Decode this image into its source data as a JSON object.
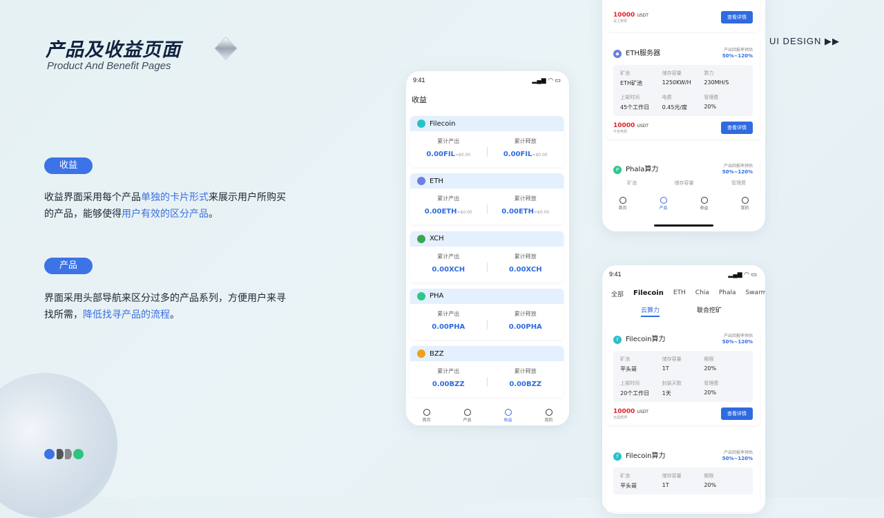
{
  "header": {
    "title": "产品及收益页面",
    "subtitle": "Product And Benefit Pages",
    "tag": "UI DESIGN ▶▶"
  },
  "section1": {
    "pill": "收益",
    "p1a": "收益界面采用每个产品",
    "p1b": "单独的卡片形式",
    "p1c": "来展示用户所购买的产品，能够使得",
    "p1d": "用户有效的区分产品",
    "p1e": "。"
  },
  "section2": {
    "pill": "产品",
    "p2a": "界面采用头部导航来区分过多的产品系列，方便用户来寻找所需，",
    "p2b": "降低找寻产品的流程",
    "p2c": "。"
  },
  "colors": {
    "accent": "#3c73e6",
    "price": "#e0202a"
  },
  "phone1": {
    "time": "9:41",
    "title": "收益",
    "cards": [
      {
        "name": "Filecoin",
        "l1": "累计产出",
        "v1": "0.00FIL",
        "s1": "≈$0.00",
        "l2": "累计释放",
        "v2": "0.00FIL",
        "s2": "≈$0.00",
        "color": "#2bc0c8"
      },
      {
        "name": "ETH",
        "l1": "累计产出",
        "v1": "0.00ETH",
        "s1": "≈$0.00",
        "l2": "累计释放",
        "v2": "0.00ETH",
        "s2": "≈$0.00",
        "color": "#6a7fe0"
      },
      {
        "name": "XCH",
        "l1": "累计产出",
        "v1": "0.00XCH",
        "s1": "",
        "l2": "累计释放",
        "v2": "0.00XCH",
        "s2": "",
        "color": "#3aa655"
      },
      {
        "name": "PHA",
        "l1": "累计产出",
        "v1": "0.00PHA",
        "s1": "",
        "l2": "累计释放",
        "v2": "0.00PHA",
        "s2": "",
        "color": "#2cc88a"
      },
      {
        "name": "BZZ",
        "l1": "累计产出",
        "v1": "0.00BZZ",
        "s1": "",
        "l2": "累计释放",
        "v2": "0.00BZZ",
        "s2": "",
        "color": "#f0a020"
      }
    ],
    "tabs": [
      "首页",
      "产品",
      "收益",
      "我的"
    ]
  },
  "phone2": {
    "top_price": "10000",
    "top_unit": "USDT",
    "top_note": "设上架费",
    "top_btn": "查看详情",
    "eth": {
      "name": "ETH服务器",
      "yl": "产出回报率预估",
      "yv": "50%~120%",
      "cells": [
        [
          "矿池",
          "ETH矿池"
        ],
        [
          "储存容量",
          "1250KW/H"
        ],
        [
          "算力",
          "230MH/S"
        ],
        [
          "上架时间",
          "45个工作日"
        ],
        [
          "电费",
          "0.45元/度"
        ],
        [
          "管理费",
          "20%"
        ]
      ],
      "price": "10000",
      "unit": "USDT",
      "note": "不含电费",
      "btn": "查看详情"
    },
    "pha": {
      "name": "Phala算力",
      "yl": "产出回报率预估",
      "yv": "50%~120%",
      "cells": [
        "矿池",
        "储存容量",
        "管理费"
      ]
    },
    "tabs": [
      "首页",
      "产品",
      "收益",
      "我的"
    ]
  },
  "phone3": {
    "time": "9:41",
    "nav": [
      "全部",
      "Filecoin",
      "ETH",
      "Chia",
      "Phala",
      "Swarm"
    ],
    "sub": [
      "云算力",
      "联合挖矿"
    ],
    "c1": {
      "name": "Filecoin算力",
      "yl": "产出回报率预估",
      "yv": "50%~120%",
      "cells": [
        [
          "矿池",
          "平头哥"
        ],
        [
          "储存容量",
          "1T"
        ],
        [
          "期限",
          "20%"
        ],
        [
          "上架时间",
          "20个工作日"
        ],
        [
          "封装天数",
          "1天"
        ],
        [
          "管理费",
          "20%"
        ]
      ],
      "price": "10000",
      "unit": "USDT",
      "note": "无需质押",
      "btn": "查看详情"
    },
    "c2": {
      "name": "Filecoin算力",
      "yl": "产出回报率预估",
      "yv": "50%~120%",
      "cells": [
        [
          "矿池",
          "平头哥"
        ],
        [
          "储存容量",
          "1T"
        ],
        [
          "期限",
          "20%"
        ]
      ]
    }
  }
}
